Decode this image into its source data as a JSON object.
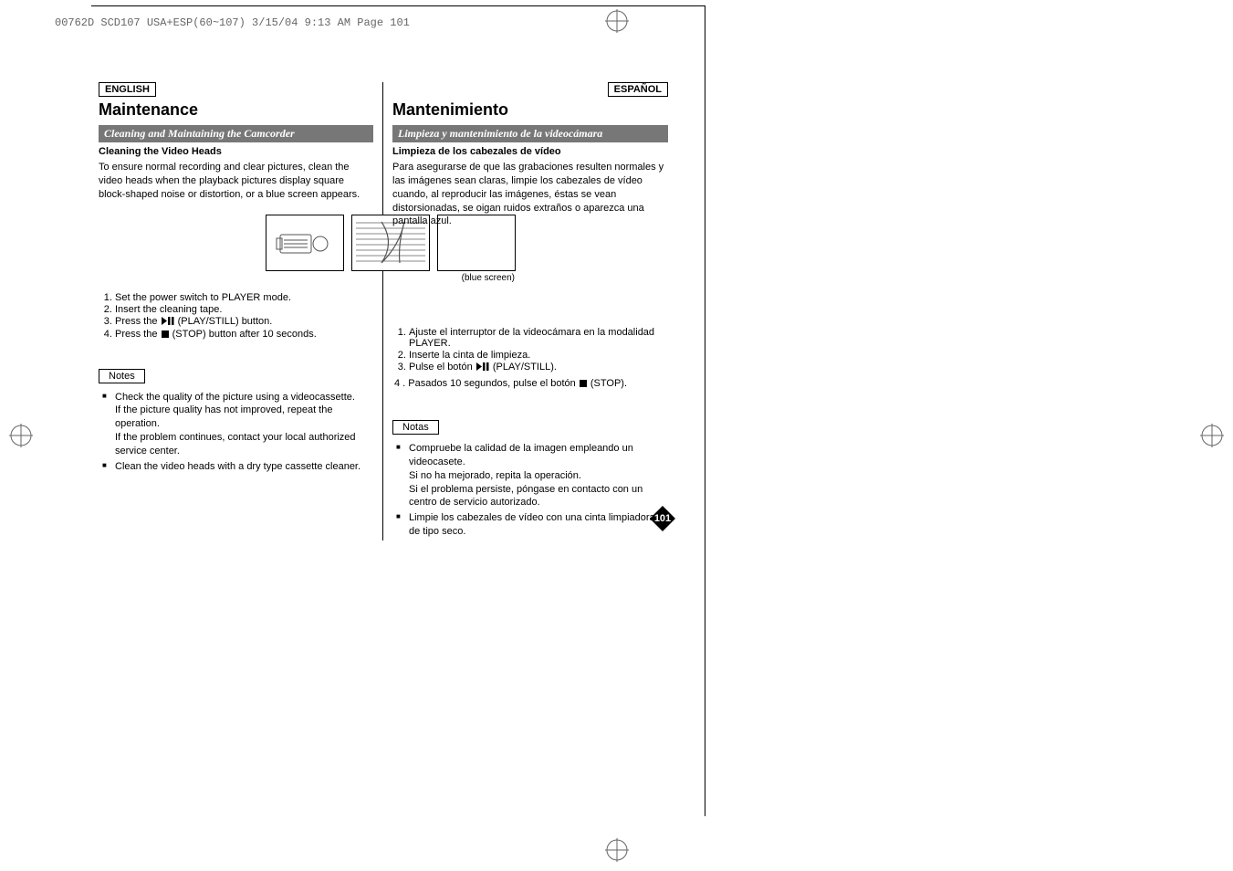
{
  "header_strip": "00762D SCD107 USA+ESP(60~107)  3/15/04 9:13 AM  Page 101",
  "left": {
    "lang": "ENGLISH",
    "title": "Maintenance",
    "sub_bar": "Cleaning and Maintaining the Camcorder",
    "sub_heading": "Cleaning the Video Heads",
    "body": "To ensure normal recording and clear pictures, clean the video heads when the playback pictures display square block-shaped noise or distortion, or a blue screen appears.",
    "steps": [
      "Set the power switch to PLAYER mode.",
      "Insert the cleaning tape.",
      "Press the   (PLAY/STILL) button.",
      "Press the   (STOP) button after 10 seconds."
    ],
    "step3_label_pre": "Press the ",
    "step3_label_post": "(PLAY/STILL) button.",
    "step4_label_pre": "Press the ",
    "step4_label_post": " (STOP) button after 10 seconds.",
    "notes_label": "Notes",
    "notes": [
      "Check the quality of the picture using a videocassette.\nIf the picture quality has not improved, repeat the operation.\nIf the problem continues, contact your local authorized service center.",
      "Clean the video heads with a dry type cassette cleaner."
    ]
  },
  "right": {
    "lang": "ESPAÑOL",
    "title": "Mantenimiento",
    "sub_bar": "Limpieza y mantenimiento de la videocámara",
    "sub_heading": "Limpieza de los cabezales de vídeo",
    "body": "Para asegurarse de que las grabaciones resulten normales y las imágenes sean claras, limpie los cabezales de vídeo cuando, al reproducir las imágenes, éstas se vean distorsionadas, se oigan ruidos extraños o aparezca una pantalla azul.",
    "steps_pre": [
      "Ajuste el interruptor de la videocámara en la modalidad PLAYER.",
      "Inserte la cinta de limpieza."
    ],
    "step3_label_pre": "Pulse el botón ",
    "step3_label_post": "(PLAY/STILL).",
    "step4_label_pre": "4 . Pasados 10 segundos, pulse el botón ",
    "step4_label_post": " (STOP).",
    "notes_label": "Notas",
    "notes": [
      "Compruebe la calidad de la imagen empleando un videocasete.\nSi no ha mejorado, repita la operación.\nSi el problema persiste, póngase en contacto con un centro de servicio autorizado.",
      "Limpie los cabezales de vídeo con una cinta limpiadora de tipo seco."
    ]
  },
  "figure_caption": "(blue screen)",
  "page_number": "101"
}
